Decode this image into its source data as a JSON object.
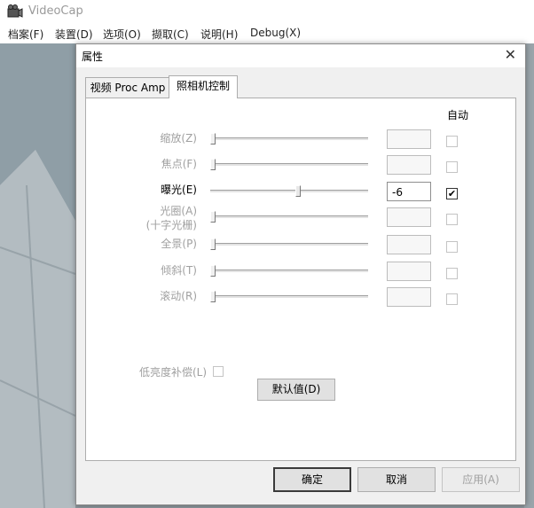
{
  "app": {
    "title": "VideoCap",
    "menu": [
      "档案(F)",
      "装置(D)",
      "选项(O)",
      "撷取(C)",
      "说明(H)",
      "Debug(X)"
    ]
  },
  "dialog": {
    "title": "属性",
    "tabs": [
      {
        "label": "视频 Proc Amp",
        "active": false
      },
      {
        "label": "照相机控制",
        "active": true
      }
    ],
    "auto_header": "自动",
    "rows": [
      {
        "label": "缩放(Z)",
        "value": "",
        "enabled": false,
        "auto": false,
        "slider": 0.0
      },
      {
        "label": "焦点(F)",
        "value": "",
        "enabled": false,
        "auto": false,
        "slider": 0.0
      },
      {
        "label": "曝光(E)",
        "value": "-6",
        "enabled": true,
        "auto": true,
        "slider": 0.56
      },
      {
        "label": "光圈(A)",
        "label2": "(十字光栅)",
        "value": "",
        "enabled": false,
        "auto": false,
        "slider": 0.0
      },
      {
        "label": "全景(P)",
        "value": "",
        "enabled": false,
        "auto": false,
        "slider": 0.0
      },
      {
        "label": "倾斜(T)",
        "value": "",
        "enabled": false,
        "auto": false,
        "slider": 0.0
      },
      {
        "label": "滚动(R)",
        "value": "",
        "enabled": false,
        "auto": false,
        "slider": 0.0
      }
    ],
    "low_light_label": "低亮度补偿(L)",
    "default_button": "默认值(D)",
    "ok_button": "确定",
    "cancel_button": "取消",
    "apply_button": "应用(A)"
  }
}
